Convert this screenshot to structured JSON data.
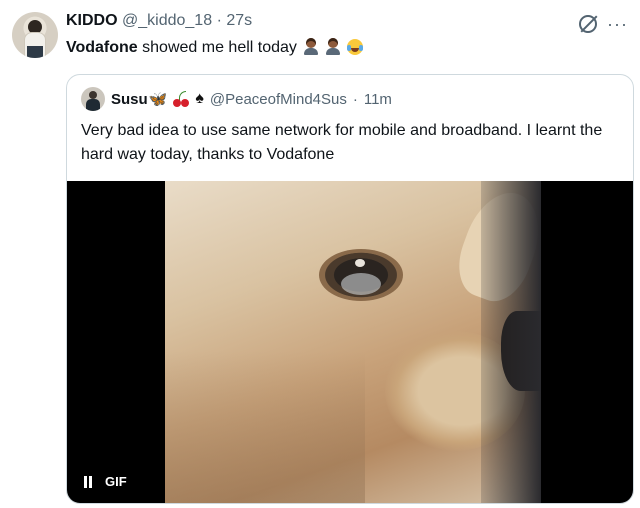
{
  "tweet": {
    "display_name": "KIDDO",
    "handle": "@_kiddo_18",
    "separator": "·",
    "time": "27s",
    "text_bold": "Vodafone",
    "text_rest": " showed me hell today",
    "emojis": [
      "person-emoji",
      "person-emoji",
      "laughing-tears-emoji"
    ]
  },
  "quote": {
    "display_name": "Susu",
    "emojis": [
      "butterfly-emoji",
      "cherries-emoji",
      "spade-emoji"
    ],
    "handle": "@PeaceofMind4Sus",
    "separator": "·",
    "time": "11m",
    "text": "Very bad idea to use same network for mobile and broadband. I learnt the hard way today, thanks to Vodafone",
    "media": {
      "badge": "GIF",
      "control": "pause-icon"
    }
  },
  "colors": {
    "text_primary": "#0f1419",
    "text_secondary": "#536471",
    "border": "#cfd9de"
  }
}
